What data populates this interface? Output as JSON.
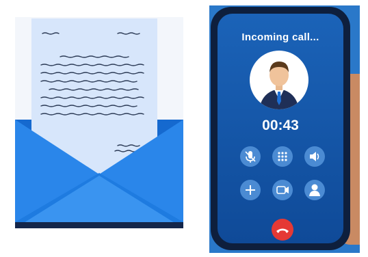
{
  "call": {
    "status": "Incoming call...",
    "timer": "00:43"
  },
  "icons": {
    "mute": "microphone-mute-icon",
    "keypad": "keypad-icon",
    "speaker": "speaker-icon",
    "add_call": "add-call-icon",
    "video": "video-camera-icon",
    "contacts": "contact-person-icon",
    "end_call": "end-call-icon"
  },
  "colors": {
    "screen": "#1b63b8",
    "end_call": "#e53935",
    "envelope": "#1e7be0",
    "letter": "#d7e6fb"
  }
}
